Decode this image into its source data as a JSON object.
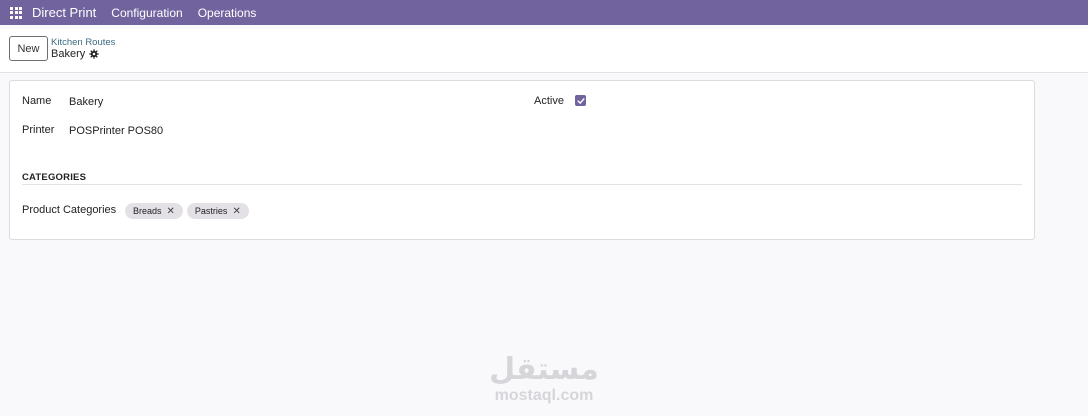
{
  "topbar": {
    "app_name": "Direct Print",
    "menu": [
      "Configuration",
      "Operations"
    ],
    "color": "#71639e"
  },
  "control_panel": {
    "new_label": "New",
    "breadcrumb_parent": "Kitchen Routes",
    "breadcrumb_current": "Bakery"
  },
  "form": {
    "name_label": "Name",
    "name_value": "Bakery",
    "printer_label": "Printer",
    "printer_value": "POSPrinter POS80",
    "active_label": "Active",
    "active_checked": true,
    "categories_section": "CATEGORIES",
    "product_categories_label": "Product Categories",
    "tags": [
      "Breads",
      "Pastries"
    ]
  },
  "icons": {
    "apps": "apps-grid-icon",
    "settings": "gear-icon",
    "check": "check-icon",
    "remove_tag": "close-icon"
  },
  "watermark": {
    "logo": "مستقل",
    "url": "mostaql.com"
  }
}
